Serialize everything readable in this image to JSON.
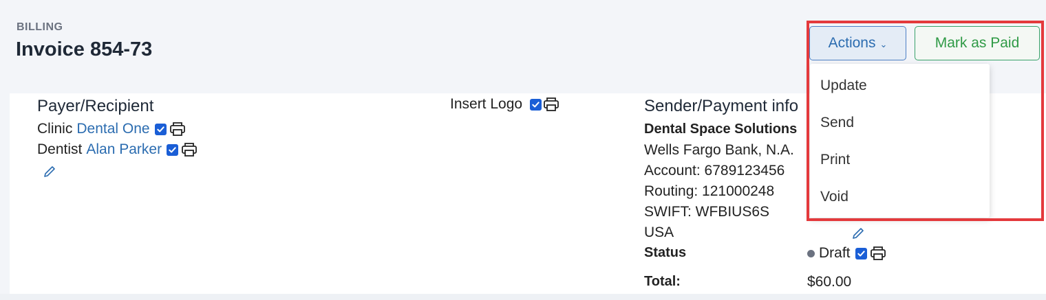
{
  "header": {
    "breadcrumb": "BILLING",
    "title": "Invoice 854-73",
    "actions_label": "Actions",
    "mark_paid_label": "Mark as Paid"
  },
  "payer": {
    "heading": "Payer/Recipient",
    "clinic_label": "Clinic",
    "clinic_name": "Dental One",
    "dentist_label": "Dentist",
    "dentist_name": "Alan Parker"
  },
  "logo": {
    "label": "Insert Logo"
  },
  "sender": {
    "heading": "Sender/Payment info",
    "company": "Dental Space Solutions",
    "bank": "Wells Fargo Bank, N.A.",
    "account": "Account: 6789123456",
    "routing": "Routing: 121000248",
    "swift": "SWIFT: WFBIUS6S",
    "country": "USA"
  },
  "summary": {
    "status_label": "Status",
    "status_value": "Draft",
    "total_label": "Total:",
    "total_value": "$60.00"
  },
  "actions_menu": {
    "items": [
      "Update",
      "Send",
      "Print",
      "Void"
    ]
  },
  "icons": {
    "checkbox": "checkbox-checked-icon",
    "printer": "printer-icon",
    "pencil": "pencil-icon",
    "chevron": "chevron-down-icon"
  },
  "colors": {
    "link": "#2b6cb0",
    "accent_blue": "#1a5ed6",
    "paid_green": "#2f9a46",
    "highlight_red": "#e4393c"
  }
}
